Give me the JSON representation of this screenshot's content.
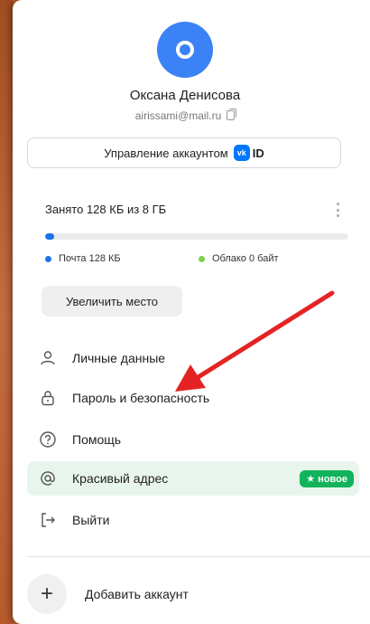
{
  "profile": {
    "name": "Оксана Денисова",
    "email": "airissami@mail.ru"
  },
  "manage_account": {
    "label": "Управление аккаунтом",
    "vk_logo_text": "vk",
    "id_text": "ID"
  },
  "storage": {
    "title": "Занято 128 КБ из 8 ГБ",
    "used_fraction": 0.03,
    "legend": [
      {
        "label": "Почта 128 КБ",
        "color": "#1a73e8"
      },
      {
        "label": "Облако 0 байт",
        "color": "#7bd34b"
      }
    ],
    "increase_label": "Увеличить место"
  },
  "menu": [
    {
      "label": "Личные данные",
      "icon": "person-icon"
    },
    {
      "label": "Пароль и безопасность",
      "icon": "lock-icon"
    },
    {
      "label": "Помощь",
      "icon": "help-icon"
    },
    {
      "label": "Красивый адрес",
      "icon": "at-icon",
      "badge": "новое"
    },
    {
      "label": "Выйти",
      "icon": "logout-icon"
    }
  ],
  "add_account": {
    "label": "Добавить аккаунт",
    "icon": "plus-icon"
  },
  "colors": {
    "avatar": "#3b82f6",
    "accent_green": "#12b35a",
    "annotation_arrow": "#e52222"
  }
}
